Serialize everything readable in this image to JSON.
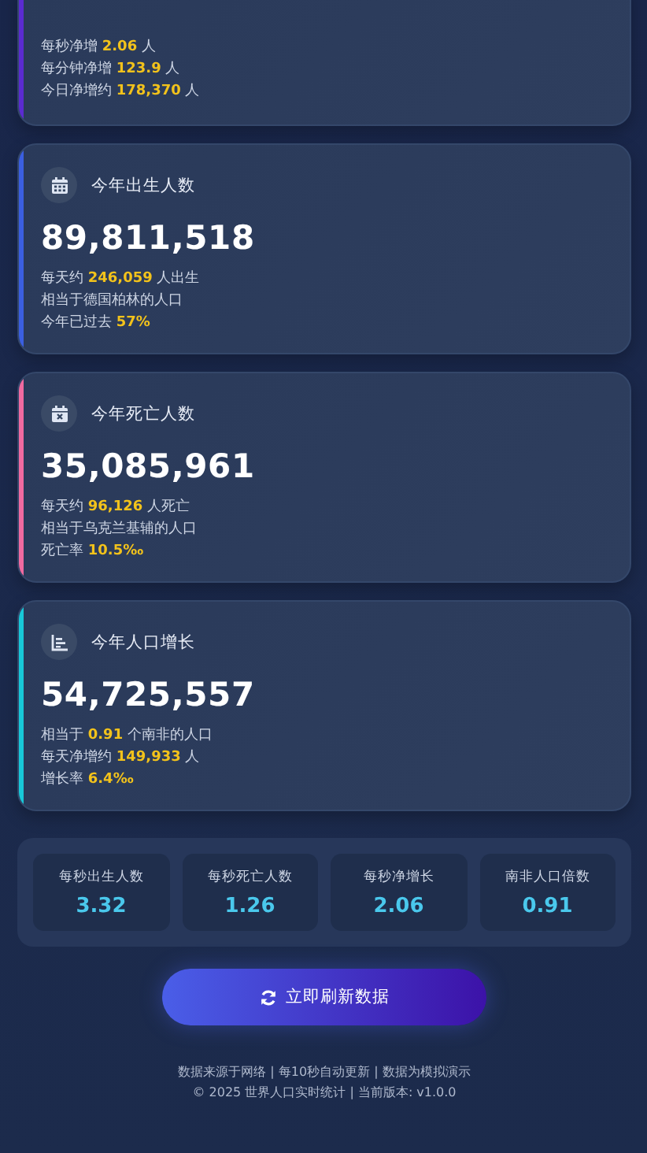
{
  "top_card": {
    "color": "#5b2bd0",
    "lines": [
      "每秒净增 **2.06** 人",
      "每分钟净增 **123.9** 人",
      "今日净增约 **178,370** 人"
    ]
  },
  "cards": [
    {
      "kind": "births",
      "color": "#3b5fe0",
      "title": "今年出生人数",
      "value": "89,811,518",
      "lines": [
        "每天约 **246,059** 人出生",
        "相当于德国柏林的人口",
        "今年已过去 **57%**"
      ]
    },
    {
      "kind": "deaths",
      "color": "#f06aa0",
      "title": "今年死亡人数",
      "value": "35,085,961",
      "lines": [
        "每天约 **96,126** 人死亡",
        "相当于乌克兰基辅的人口",
        "死亡率 **10.5‰**"
      ]
    },
    {
      "kind": "growth",
      "color": "#18c8d8",
      "title": "今年人口增长",
      "value": "54,725,557",
      "lines": [
        "相当于 **0.91** 个南非的人口",
        "每天净增约 **149,933** 人",
        "增长率 **6.4‰**"
      ]
    }
  ],
  "stats": [
    {
      "label": "每秒出生人数",
      "value": "3.32"
    },
    {
      "label": "每秒死亡人数",
      "value": "1.26"
    },
    {
      "label": "每秒净增长",
      "value": "2.06"
    },
    {
      "label": "南非人口倍数",
      "value": "0.91"
    }
  ],
  "refresh_button": {
    "label": "立即刷新数据"
  },
  "footer": [
    "数据来源于网络 | 每10秒自动更新 | 数据为模拟演示",
    "© 2025 世界人口实时统计 | 当前版本: v1.0.0"
  ]
}
